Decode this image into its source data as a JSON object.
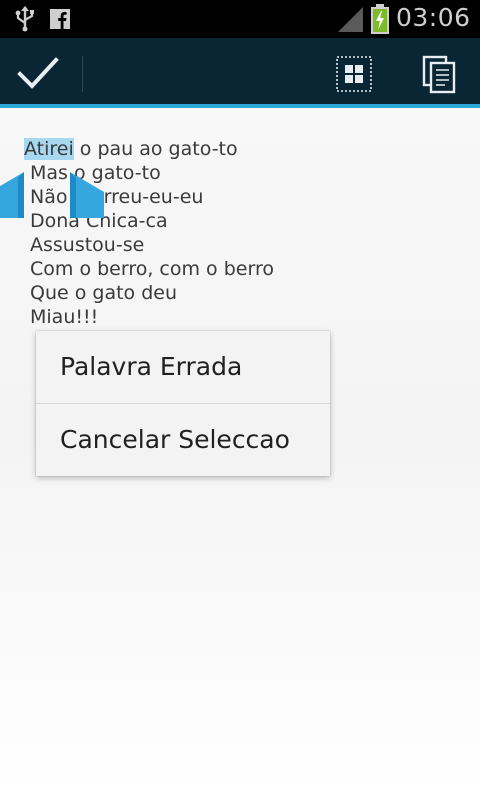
{
  "status_bar": {
    "time": "03:06",
    "icons": [
      "usb-icon",
      "facebook-icon",
      "signal-icon",
      "battery-charging-icon"
    ]
  },
  "action_bar": {
    "icons": [
      "check-icon",
      "select-all-icon",
      "copy-icon"
    ],
    "accent_color": "#2aa9d9",
    "background_color": "#0a2533"
  },
  "text": {
    "selected_word": "Atirei",
    "lines": [
      " o pau ao gato-to",
      "Mas o gato-to",
      "Não morreu-eu-eu",
      "Dona Chica-ca",
      "Assustou-se",
      "Com o berro, com o berro",
      "Que o gato deu",
      "Miau!!!"
    ]
  },
  "context_menu": {
    "items": [
      {
        "label": "Palavra Errada"
      },
      {
        "label": "Cancelar Seleccao"
      }
    ]
  },
  "selection_color": "#a8d8ef"
}
